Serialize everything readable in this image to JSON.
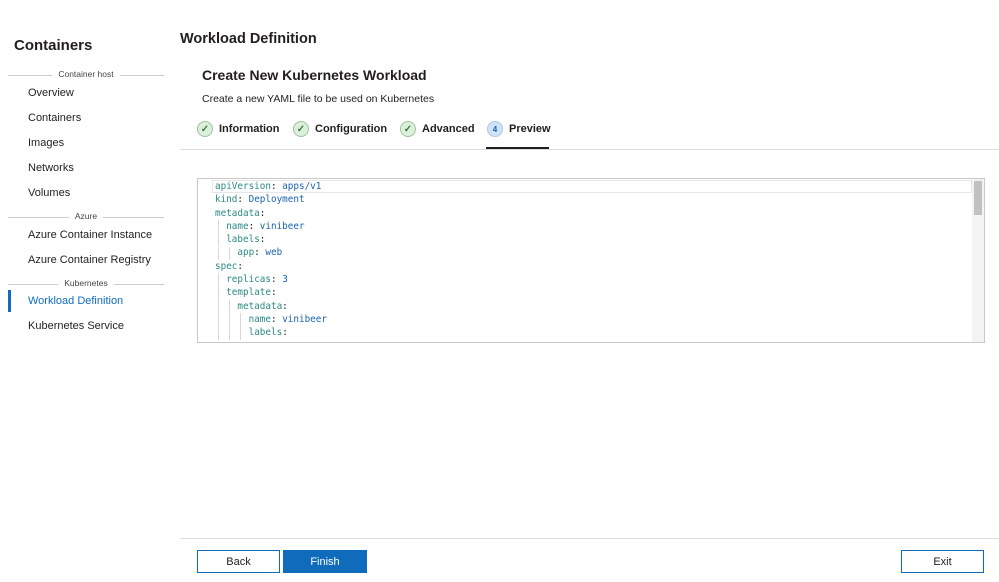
{
  "sidebar": {
    "title": "Containers",
    "sections": [
      {
        "label": "Container host",
        "items": [
          "Overview",
          "Containers",
          "Images",
          "Networks",
          "Volumes"
        ]
      },
      {
        "label": "Azure",
        "items": [
          "Azure Container Instance",
          "Azure Container Registry"
        ]
      },
      {
        "label": "Kubernetes",
        "items": [
          "Workload Definition",
          "Kubernetes Service"
        ]
      }
    ],
    "active": "Workload Definition"
  },
  "page_title": "Workload Definition",
  "wizard": {
    "title": "Create New Kubernetes Workload",
    "subtitle": "Create a new YAML file to be used on Kubernetes",
    "steps": [
      {
        "label": "Information",
        "state": "done"
      },
      {
        "label": "Configuration",
        "state": "done"
      },
      {
        "label": "Advanced",
        "state": "done"
      },
      {
        "label": "Preview",
        "state": "current",
        "number": "4"
      }
    ]
  },
  "editor": {
    "lines": [
      {
        "indent": 0,
        "key": "apiVersion",
        "value": "apps/v1"
      },
      {
        "indent": 0,
        "key": "kind",
        "value": "Deployment"
      },
      {
        "indent": 0,
        "key": "metadata",
        "value": ""
      },
      {
        "indent": 1,
        "key": "name",
        "value": "vinibeer"
      },
      {
        "indent": 1,
        "key": "labels",
        "value": ""
      },
      {
        "indent": 2,
        "key": "app",
        "value": "web"
      },
      {
        "indent": 0,
        "key": "spec",
        "value": ""
      },
      {
        "indent": 1,
        "key": "replicas",
        "value": "3"
      },
      {
        "indent": 1,
        "key": "template",
        "value": ""
      },
      {
        "indent": 2,
        "key": "metadata",
        "value": ""
      },
      {
        "indent": 3,
        "key": "name",
        "value": "vinibeer"
      },
      {
        "indent": 3,
        "key": "labels",
        "value": ""
      }
    ]
  },
  "footer": {
    "back": "Back",
    "finish": "Finish",
    "exit": "Exit"
  },
  "colors": {
    "accent": "#0f6cbd",
    "yaml_key": "#2b8a86",
    "yaml_value": "#1c63b0"
  }
}
